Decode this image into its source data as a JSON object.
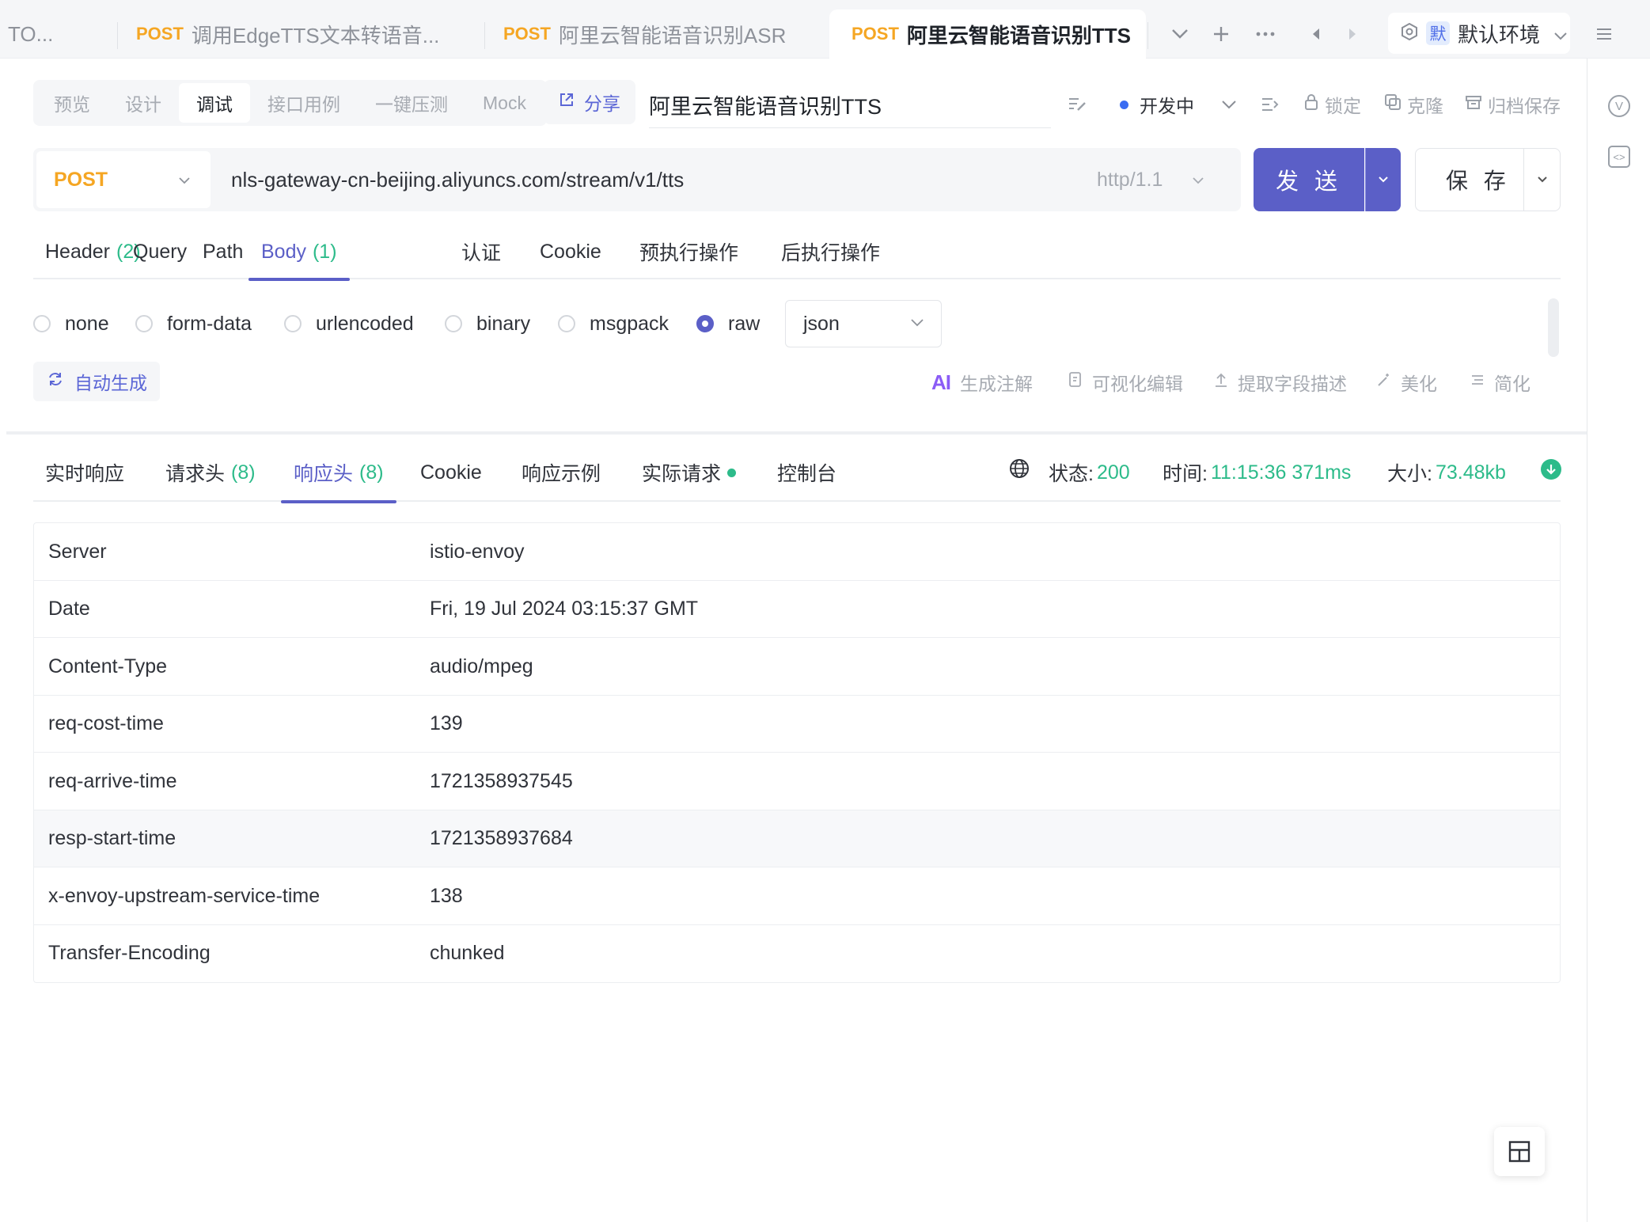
{
  "tabs": {
    "truncated": "TO...",
    "items": [
      {
        "method": "POST",
        "label": "调用EdgeTTS文本转语音..."
      },
      {
        "method": "POST",
        "label": "阿里云智能语音识别ASR"
      },
      {
        "method": "POST",
        "label": "阿里云智能语音识别TTS"
      }
    ],
    "env_badge": "默",
    "env_label": "默认环境"
  },
  "modes": [
    "预览",
    "设计",
    "调试",
    "接口用例",
    "一键压测",
    "Mock"
  ],
  "share_label": "分享",
  "api_name": "阿里云智能语音识别TTS",
  "status_label": "开发中",
  "actions": {
    "lock": "锁定",
    "clone": "克隆",
    "archive": "归档保存"
  },
  "request": {
    "method": "POST",
    "url": "nls-gateway-cn-beijing.aliyuncs.com/stream/v1/tts",
    "protocol": "http/1.1",
    "send_label": "发 送",
    "save_label": "保 存"
  },
  "req_tabs": [
    {
      "label": "Header",
      "count": "(2)"
    },
    {
      "label": "Query",
      "count": ""
    },
    {
      "label": "Path",
      "count": ""
    },
    {
      "label": "Body",
      "count": "(1)"
    },
    {
      "label": "认证",
      "count": ""
    },
    {
      "label": "Cookie",
      "count": ""
    },
    {
      "label": "预执行操作",
      "count": ""
    },
    {
      "label": "后执行操作",
      "count": ""
    }
  ],
  "body_types": [
    "none",
    "form-data",
    "urlencoded",
    "binary",
    "msgpack",
    "raw"
  ],
  "body_format": "json",
  "auto_generate": "自动生成",
  "tools": {
    "ai_mark": "AI",
    "gen_comments": "生成注解",
    "visual_edit": "可视化编辑",
    "extract_desc": "提取字段描述",
    "beautify": "美化",
    "simplify": "简化"
  },
  "resp_tabs": [
    {
      "label": "实时响应",
      "count": ""
    },
    {
      "label": "请求头",
      "count": "(8)"
    },
    {
      "label": "响应头",
      "count": "(8)"
    },
    {
      "label": "Cookie",
      "count": ""
    },
    {
      "label": "响应示例",
      "count": ""
    },
    {
      "label": "实际请求",
      "count": ""
    },
    {
      "label": "控制台",
      "count": ""
    }
  ],
  "response_meta": {
    "status_label": "状态:",
    "status": "200",
    "time_label": "时间:",
    "time": "11:15:36 371ms",
    "size_label": "大小:",
    "size": "73.48kb"
  },
  "headers": [
    {
      "key": "Server",
      "value": "istio-envoy"
    },
    {
      "key": "Date",
      "value": "Fri, 19 Jul 2024 03:15:37 GMT"
    },
    {
      "key": "Content-Type",
      "value": "audio/mpeg"
    },
    {
      "key": "req-cost-time",
      "value": "139"
    },
    {
      "key": "req-arrive-time",
      "value": "1721358937545"
    },
    {
      "key": "resp-start-time",
      "value": "1721358937684"
    },
    {
      "key": "x-envoy-upstream-service-time",
      "value": "138"
    },
    {
      "key": "Transfer-Encoding",
      "value": "chunked"
    }
  ],
  "colors": {
    "accent": "#5b5fc7",
    "method_post": "#f5a623",
    "success": "#2dbb8a",
    "status_dot": "#3a6cf2"
  }
}
